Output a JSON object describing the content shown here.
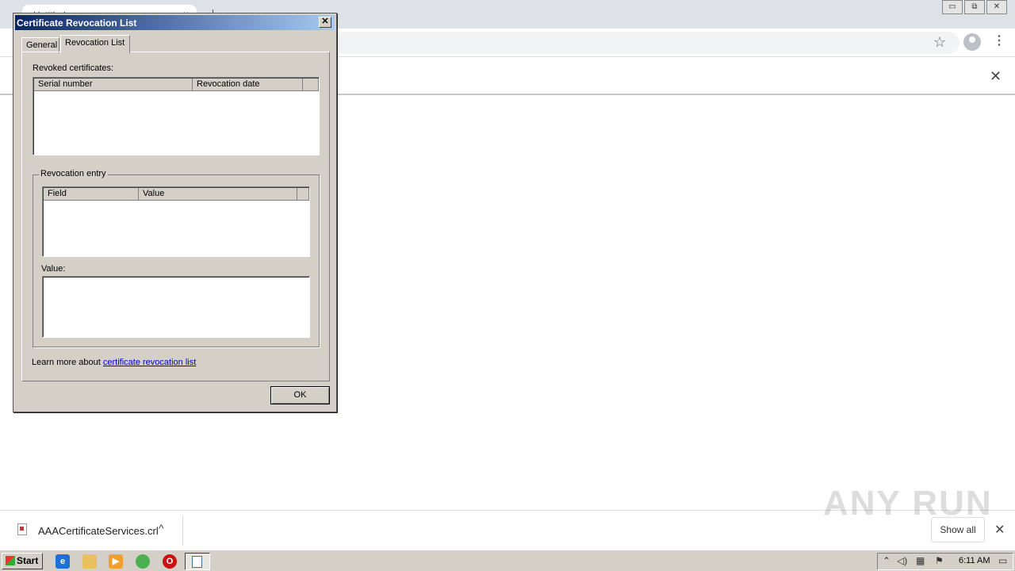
{
  "browser": {
    "tab_title": "Untitled",
    "tab_close": "×",
    "window_controls": [
      "▭",
      "⧉",
      "✕"
    ],
    "star_icon": "☆",
    "menu_icon": "⋮",
    "infobar_close": "✕"
  },
  "dialog": {
    "title": "Certificate Revocation List",
    "close_label": "✕",
    "tabs": [
      {
        "label": "General",
        "active": false
      },
      {
        "label": "Revocation List",
        "active": true
      }
    ],
    "revoked_label": "Revoked certificates:",
    "revoked_columns": [
      "Serial number",
      "Revocation date"
    ],
    "entry_group_label": "Revocation entry",
    "entry_columns": [
      "Field",
      "Value"
    ],
    "value_label": "Value:",
    "learn_more_prefix": "Learn more about ",
    "learn_more_link": "certificate revocation list",
    "ok_label": "OK"
  },
  "download_shelf": {
    "file_name": "AAACertificateServices.crl",
    "chevron": "^",
    "show_all": "Show all",
    "close": "✕",
    "watermark": "ANY RUN"
  },
  "taskbar": {
    "start_label": "Start",
    "clock": "6:11 AM",
    "pinned_icons": [
      "internet-explorer-icon",
      "folder-icon",
      "media-player-icon",
      "chrome-icon",
      "opera-icon",
      "document-icon"
    ]
  }
}
